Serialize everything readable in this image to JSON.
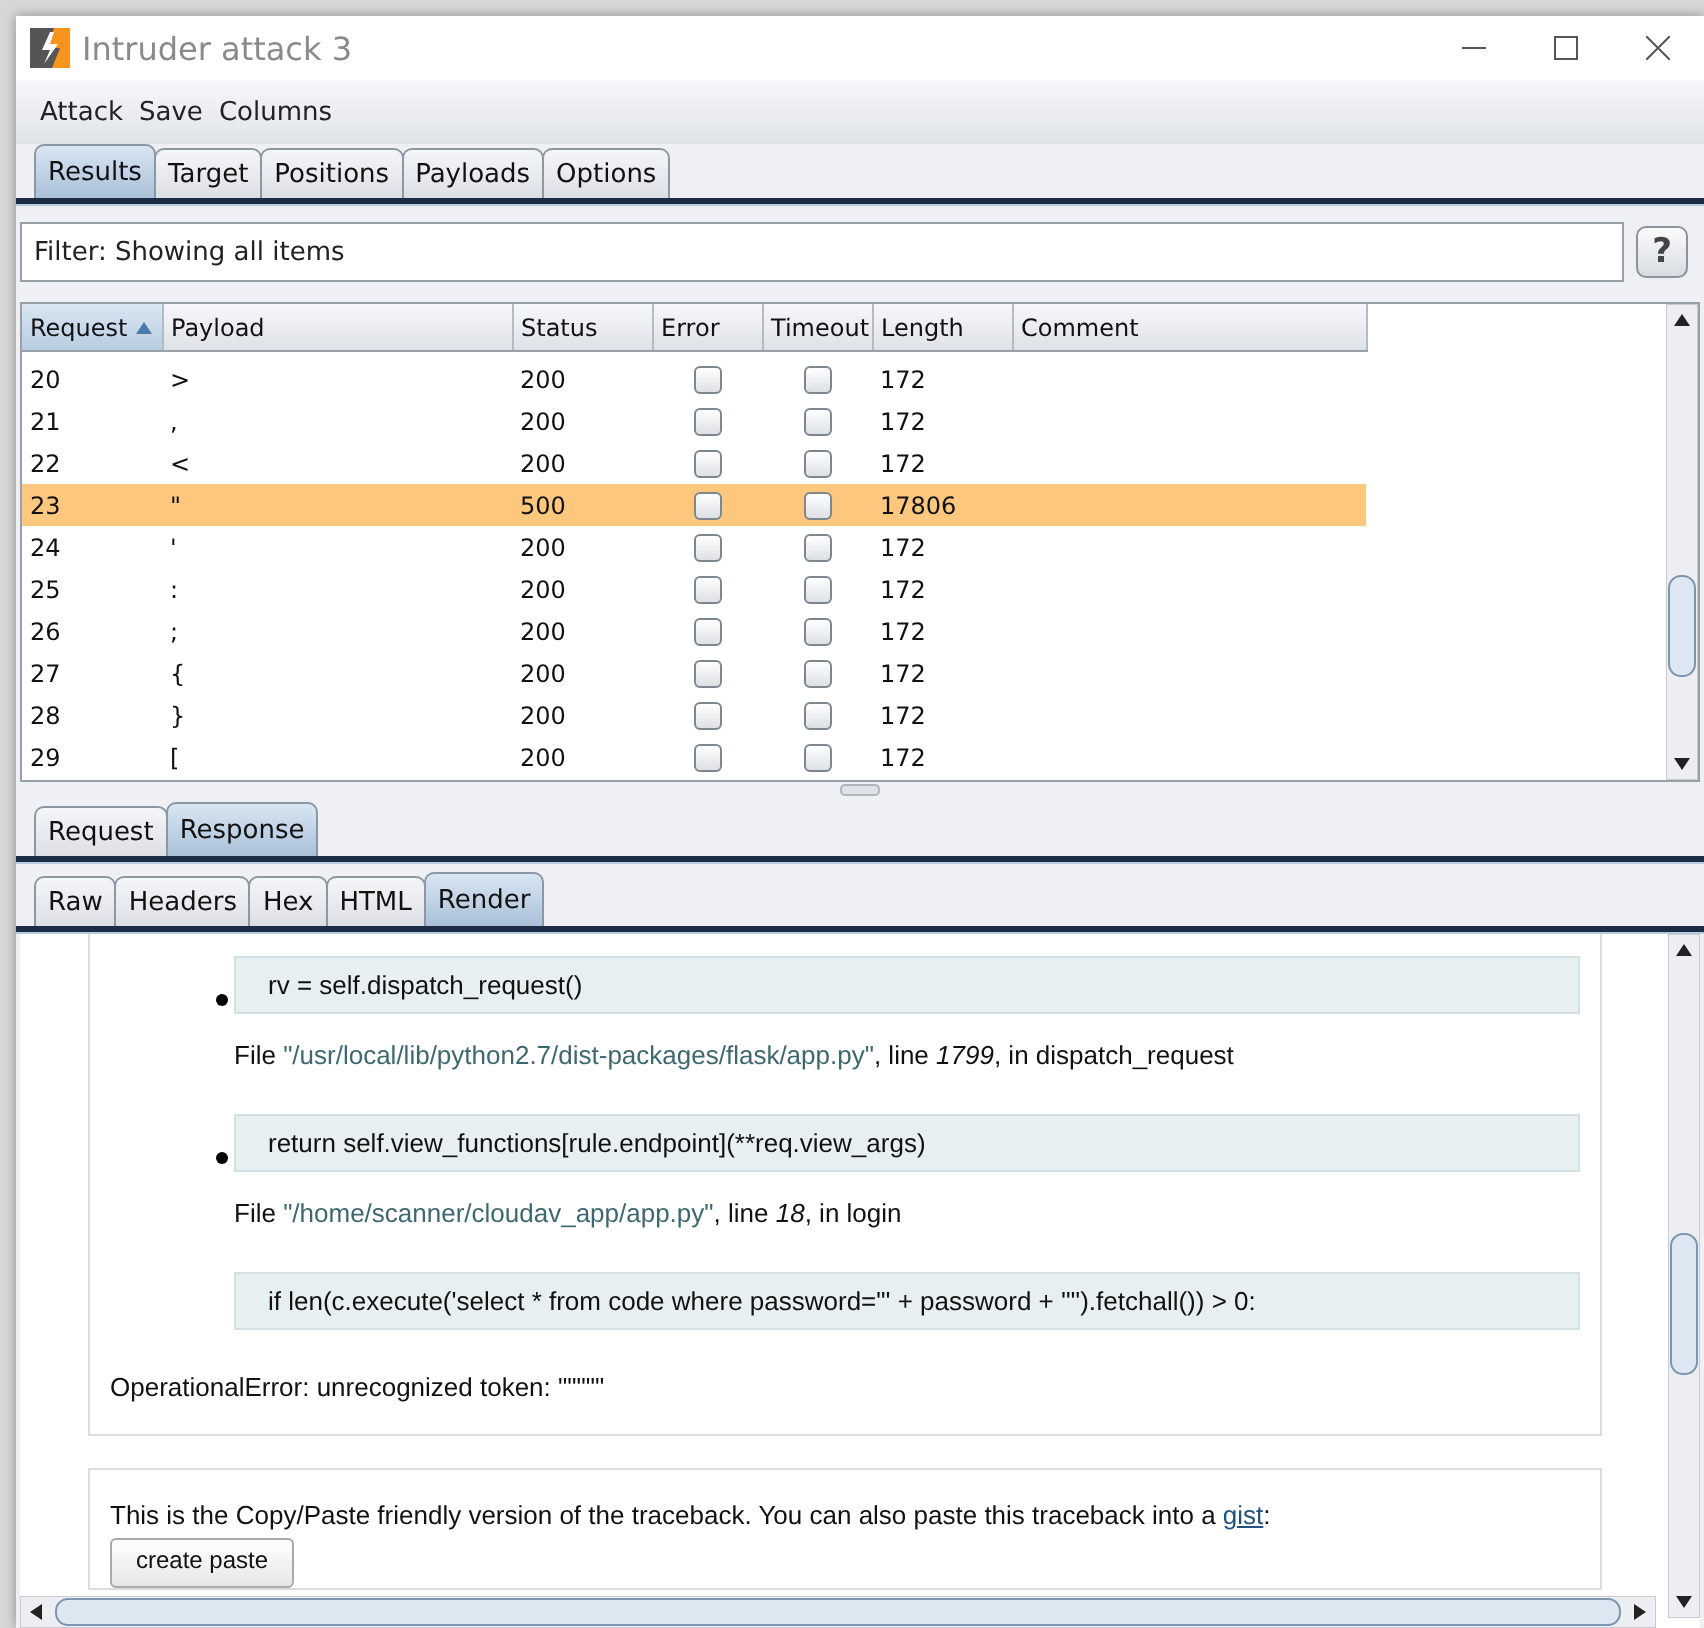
{
  "window": {
    "title": "Intruder attack 3"
  },
  "menu": [
    "Attack",
    "Save",
    "Columns"
  ],
  "tabs": [
    {
      "label": "Results",
      "selected": true
    },
    {
      "label": "Target",
      "selected": false
    },
    {
      "label": "Positions",
      "selected": false
    },
    {
      "label": "Payloads",
      "selected": false
    },
    {
      "label": "Options",
      "selected": false
    }
  ],
  "filter": {
    "text": "Filter: Showing all items",
    "help": "?"
  },
  "table": {
    "columns": [
      {
        "label": "Request",
        "sorted": true
      },
      {
        "label": "Payload",
        "sorted": false
      },
      {
        "label": "Status",
        "sorted": false
      },
      {
        "label": "Error",
        "sorted": false
      },
      {
        "label": "Timeout",
        "sorted": false
      },
      {
        "label": "Length",
        "sorted": false
      },
      {
        "label": "Comment",
        "sorted": false
      }
    ],
    "rows": [
      {
        "request": "20",
        "payload": ">",
        "status": "200",
        "error": false,
        "timeout": false,
        "length": "172",
        "selected": false
      },
      {
        "request": "21",
        "payload": ",",
        "status": "200",
        "error": false,
        "timeout": false,
        "length": "172",
        "selected": false
      },
      {
        "request": "22",
        "payload": "<",
        "status": "200",
        "error": false,
        "timeout": false,
        "length": "172",
        "selected": false
      },
      {
        "request": "23",
        "payload": "\"",
        "status": "500",
        "error": false,
        "timeout": false,
        "length": "17806",
        "selected": true
      },
      {
        "request": "24",
        "payload": "'",
        "status": "200",
        "error": false,
        "timeout": false,
        "length": "172",
        "selected": false
      },
      {
        "request": "25",
        "payload": ":",
        "status": "200",
        "error": false,
        "timeout": false,
        "length": "172",
        "selected": false
      },
      {
        "request": "26",
        "payload": ";",
        "status": "200",
        "error": false,
        "timeout": false,
        "length": "172",
        "selected": false
      },
      {
        "request": "27",
        "payload": "{",
        "status": "200",
        "error": false,
        "timeout": false,
        "length": "172",
        "selected": false
      },
      {
        "request": "28",
        "payload": "}",
        "status": "200",
        "error": false,
        "timeout": false,
        "length": "172",
        "selected": false
      },
      {
        "request": "29",
        "payload": "[",
        "status": "200",
        "error": false,
        "timeout": false,
        "length": "172",
        "selected": false
      }
    ]
  },
  "message_tabs": [
    {
      "label": "Request",
      "selected": false
    },
    {
      "label": "Response",
      "selected": true
    }
  ],
  "view_tabs": [
    {
      "label": "Raw",
      "selected": false
    },
    {
      "label": "Headers",
      "selected": false
    },
    {
      "label": "Hex",
      "selected": false
    },
    {
      "label": "HTML",
      "selected": false
    },
    {
      "label": "Render",
      "selected": true
    }
  ],
  "render": {
    "frames": [
      {
        "code": "rv = self.dispatch_request()",
        "bullet": true,
        "file": [
          {
            "kind": "plain",
            "text": "File "
          },
          {
            "kind": "path",
            "text": "\"/usr/local/lib/python2.7/dist-packages/flask/app.py\""
          },
          {
            "kind": "plain",
            "text": ", line "
          },
          {
            "kind": "num",
            "text": "1799"
          },
          {
            "kind": "plain",
            "text": ", in dispatch_request"
          }
        ]
      },
      {
        "code": "return self.view_functions[rule.endpoint](**req.view_args)",
        "bullet": true,
        "file": [
          {
            "kind": "plain",
            "text": "File "
          },
          {
            "kind": "path",
            "text": "\"/home/scanner/cloudav_app/app.py\""
          },
          {
            "kind": "plain",
            "text": ", line "
          },
          {
            "kind": "num",
            "text": "18"
          },
          {
            "kind": "plain",
            "text": ", in login"
          }
        ]
      },
      {
        "code": "if len(c.execute('select * from code where password=\"' + password + '\"').fetchall()) > 0:",
        "bullet": false
      }
    ],
    "error": "OperationalError: unrecognized token: \"\"\"\"\"",
    "paste_note": [
      {
        "kind": "plain",
        "text": "This is the Copy/Paste friendly version of the traceback. You can also paste this traceback into a "
      },
      {
        "kind": "link",
        "text": "gist"
      },
      {
        "kind": "plain",
        "text": ":"
      }
    ],
    "paste_button": "create paste"
  }
}
